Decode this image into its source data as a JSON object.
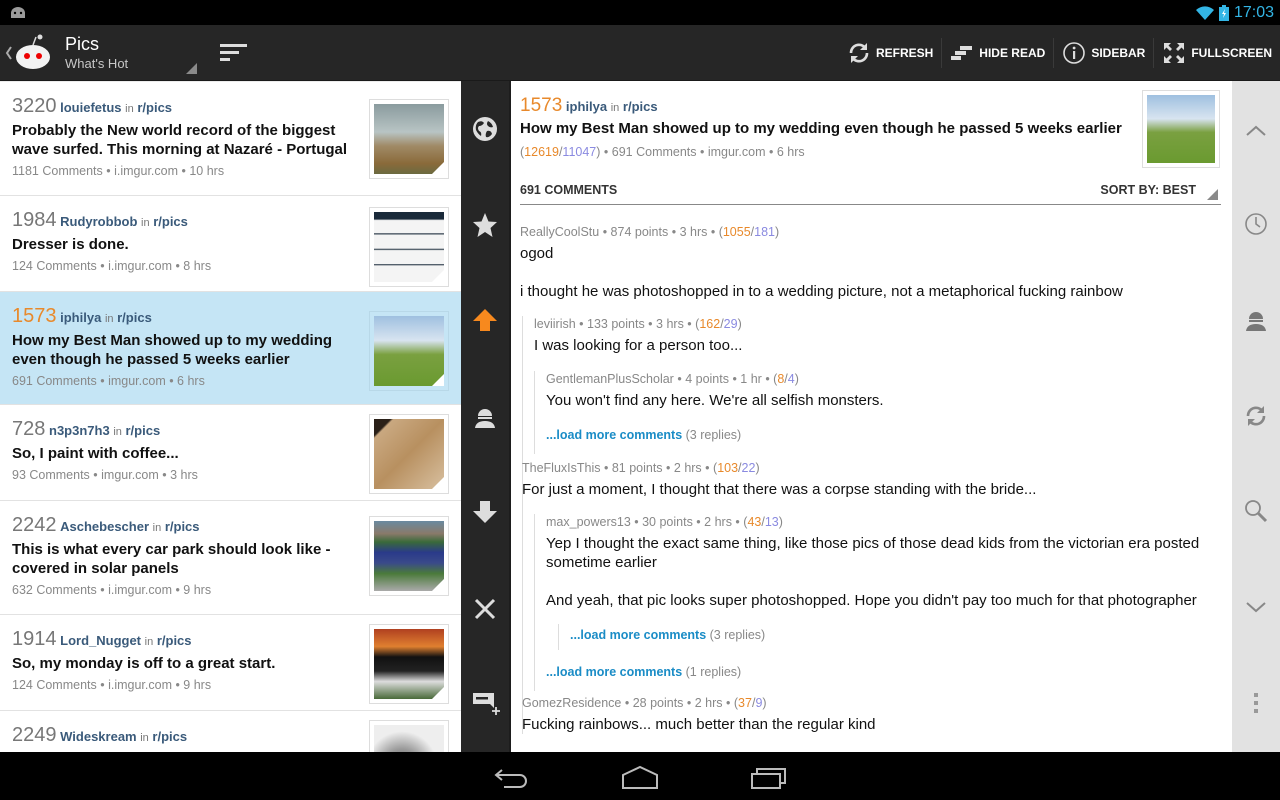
{
  "status_bar": {
    "time": "17:03",
    "icons": [
      "android-notification-icon",
      "wifi-icon",
      "battery-charging-icon"
    ]
  },
  "action_bar": {
    "title": "Pics",
    "subtitle": "What's Hot",
    "actions": [
      {
        "label": "REFRESH",
        "icon": "refresh-icon"
      },
      {
        "label": "HIDE READ",
        "icon": "hide-read-icon"
      },
      {
        "label": "SIDEBAR",
        "icon": "info-icon"
      },
      {
        "label": "FULLSCREEN",
        "icon": "fullscreen-icon"
      }
    ]
  },
  "posts": [
    {
      "score": "3220",
      "author": "louiefetus",
      "in": "in",
      "subreddit": "r/pics",
      "title": "Probably the New world record of the biggest wave surfed. This morning at Nazaré - Portugal",
      "meta": "1181 Comments • i.imgur.com • 10 hrs",
      "selected": false
    },
    {
      "score": "1984",
      "author": "Rudyrobbob",
      "in": "in",
      "subreddit": "r/pics",
      "title": "Dresser is done.",
      "meta": "124 Comments • i.imgur.com • 8 hrs",
      "selected": false
    },
    {
      "score": "1573",
      "author": "iphilya",
      "in": "in",
      "subreddit": "r/pics",
      "title": "How my Best Man showed up to my wedding even though he passed 5 weeks earlier",
      "meta": "691 Comments • imgur.com • 6 hrs",
      "selected": true
    },
    {
      "score": "728",
      "author": "n3p3n7h3",
      "in": "in",
      "subreddit": "r/pics",
      "title": "So, I paint with coffee...",
      "meta": "93 Comments • imgur.com • 3 hrs",
      "selected": false
    },
    {
      "score": "2242",
      "author": "Aschebescher",
      "in": "in",
      "subreddit": "r/pics",
      "title": "This is what every car park should look like - covered in solar panels",
      "meta": "632 Comments • i.imgur.com • 9 hrs",
      "selected": false
    },
    {
      "score": "1914",
      "author": "Lord_Nugget",
      "in": "in",
      "subreddit": "r/pics",
      "title": "So, my monday is off to a great start.",
      "meta": "124 Comments • i.imgur.com • 9 hrs",
      "selected": false
    },
    {
      "score": "2249",
      "author": "Wideskream",
      "in": "in",
      "subreddit": "r/pics",
      "title": "",
      "meta": "",
      "selected": false
    }
  ],
  "vote_bar": {
    "icons": [
      "globe-icon",
      "star-icon",
      "upvote-icon",
      "user-icon",
      "downvote-icon",
      "close-icon",
      "add-comment-icon"
    ],
    "upvote_color": "#f7891e"
  },
  "detail": {
    "score": "1573",
    "author": "iphilya",
    "in": "in",
    "subreddit": "r/pics",
    "title": "How my Best Man showed up to my wedding even though he passed 5 weeks earlier",
    "ups": "12619",
    "downs": "11047",
    "meta_rest": " • 691 Comments • imgur.com • 6 hrs",
    "comments_count_label": "691 COMMENTS",
    "sort_label": "SORT BY: BEST",
    "comments": [
      {
        "author": "ReallyCoolStu",
        "points": "874 points",
        "age": "3 hrs",
        "ups": "1055",
        "downs": "181",
        "body": [
          "ogod",
          "i thought he was photoshopped in to a wedding picture, not a metaphorical fucking rainbow"
        ]
      },
      {
        "author": "leviirish",
        "points": "133 points",
        "age": "3 hrs",
        "ups": "162",
        "downs": "29",
        "body": [
          "I was looking for a person too..."
        ]
      },
      {
        "author": "GentlemanPlusScholar",
        "points": "4 points",
        "age": "1 hr",
        "ups": "8",
        "downs": "4",
        "body": [
          "You won't find any here. We're all selfish monsters."
        ]
      },
      {
        "author": "TheFluxIsThis",
        "points": "81 points",
        "age": "2 hrs",
        "ups": "103",
        "downs": "22",
        "body": [
          "For just a moment, I thought that there was a corpse standing with the bride..."
        ]
      },
      {
        "author": "max_powers13",
        "points": "30 points",
        "age": "2 hrs",
        "ups": "43",
        "downs": "13",
        "body": [
          "Yep I thought the exact same thing, like those pics of those dead kids from the victorian era posted sometime earlier",
          "And yeah, that pic looks super photoshopped. Hope you didn't pay too much for that photographer"
        ]
      },
      {
        "author": "GomezResidence",
        "points": "28 points",
        "age": "2 hrs",
        "ups": "37",
        "downs": "9",
        "body": [
          "Fucking rainbows... much better than the regular kind"
        ]
      }
    ],
    "load_more": [
      {
        "label": "...load more comments",
        "count": "(3 replies)"
      },
      {
        "label": "...load more comments",
        "count": "(3 replies)"
      },
      {
        "label": "...load more comments",
        "count": "(1 replies)"
      }
    ],
    "sep": " • "
  },
  "right_bar": {
    "icons": [
      "scroll-up-icon",
      "history-icon",
      "user-icon",
      "refresh-icon",
      "search-icon",
      "scroll-down-icon",
      "overflow-menu-icon"
    ]
  },
  "nav_bar": {
    "buttons": [
      "back-button",
      "home-button",
      "recents-button"
    ]
  }
}
